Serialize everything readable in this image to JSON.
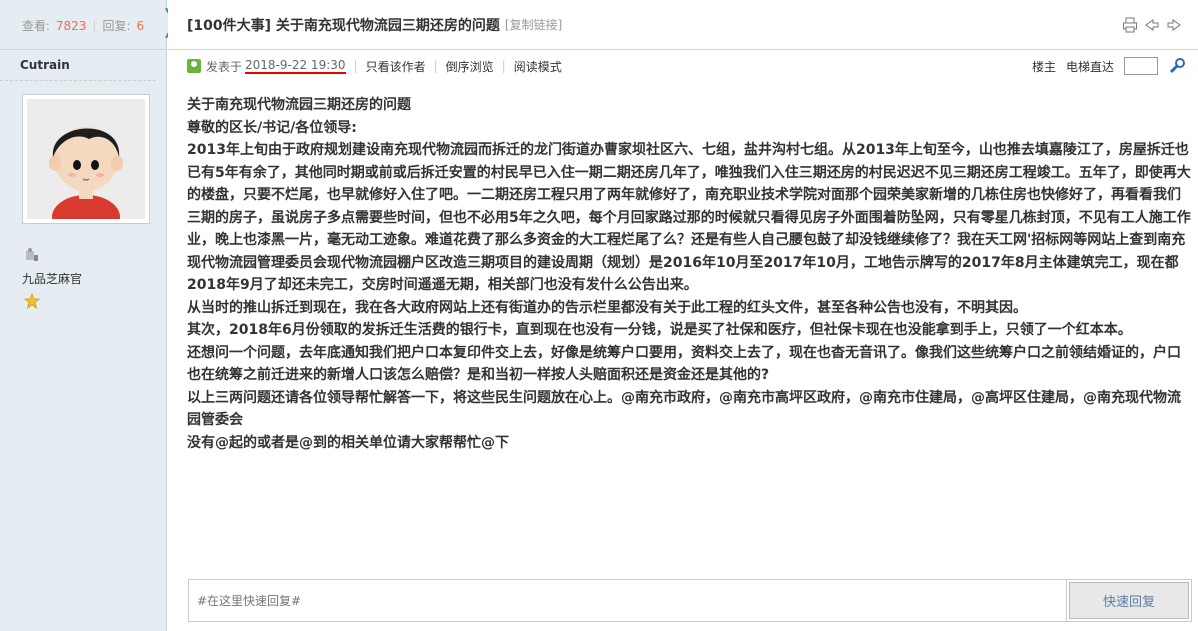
{
  "stats": {
    "view_label": "查看:",
    "views": "7823",
    "reply_label": "回复:",
    "replies": "6"
  },
  "thread": {
    "title": "[100件大事] 关于南充现代物流园三期还房的问题",
    "copy_link": "[复制链接]"
  },
  "author": {
    "name": "Cutrain",
    "rank": "九品芝麻官"
  },
  "meta": {
    "posted_label": "发表于",
    "posted_time": "2018-9-22 19:30",
    "only_author": "只看该作者",
    "reverse": "倒序浏览",
    "read_mode": "阅读模式",
    "floor": "楼主",
    "elevator": "电梯直达"
  },
  "content": [
    "关于南充现代物流园三期还房的问题",
    "尊敬的区长/书记/各位领导:",
    "2013年上旬由于政府规划建设南充现代物流园而拆迁的龙门街道办曹家坝社区六、七组，盐井沟村七组。从2013年上旬至今，山也推去填嘉陵江了，房屋拆迁也已有5年有余了，其他同时期或前或后拆迁安置的村民早已入住一期二期还房几年了，唯独我们入住三期还房的村民迟迟不见三期还房工程竣工。五年了，即使再大的楼盘，只要不烂尾，也早就修好入住了吧。一二期还房工程只用了两年就修好了，南充职业技术学院对面那个园荣美家新增的几栋住房也快修好了，再看看我们三期的房子，虽说房子多点需要些时间，但也不必用5年之久吧，每个月回家路过那的时候就只看得见房子外面围着防坠网，只有零星几栋封顶，不见有工人施工作业，晚上也漆黑一片，毫无动工迹象。难道花费了那么多资金的大工程烂尾了么？还是有些人自己腰包鼓了却没钱继续修了？我在天工网'招标网等网站上查到南充现代物流园管理委员会现代物流园棚户区改造三期项目的建设周期（规划）是2016年10月至2017年10月，工地告示牌写的2017年8月主体建筑完工，现在都2018年9月了却还未完工，交房时间遥遥无期，相关部门也没有发什么公告出来。",
    "从当时的推山拆迁到现在，我在各大政府网站上还有街道办的告示栏里都没有关于此工程的红头文件，甚至各种公告也没有，不明其因。",
    "其次，2018年6月份领取的发拆迁生活费的银行卡，直到现在也没有一分钱，说是买了社保和医疗，但社保卡现在也没能拿到手上，只领了一个红本本。",
    "还想问一个问题，去年底通知我们把户口本复印件交上去，好像是统筹户口要用，资料交上去了，现在也杳无音讯了。像我们这些统筹户口之前领结婚证的，户口也在统筹之前迁进来的新增人口该怎么赔偿？是和当初一样按人头赔面积还是资金还是其他的?",
    "以上三两问题还请各位领导帮忙解答一下，将这些民生问题放在心上。@南充市政府，@南充市高坪区政府，@南充市住建局，@高坪区住建局，@南充现代物流园管委会",
    "没有@起的或者是@到的相关单位请大家帮帮忙@下"
  ],
  "quick_reply": {
    "placeholder": "#在这里快速回复#",
    "button": "快速回复"
  }
}
